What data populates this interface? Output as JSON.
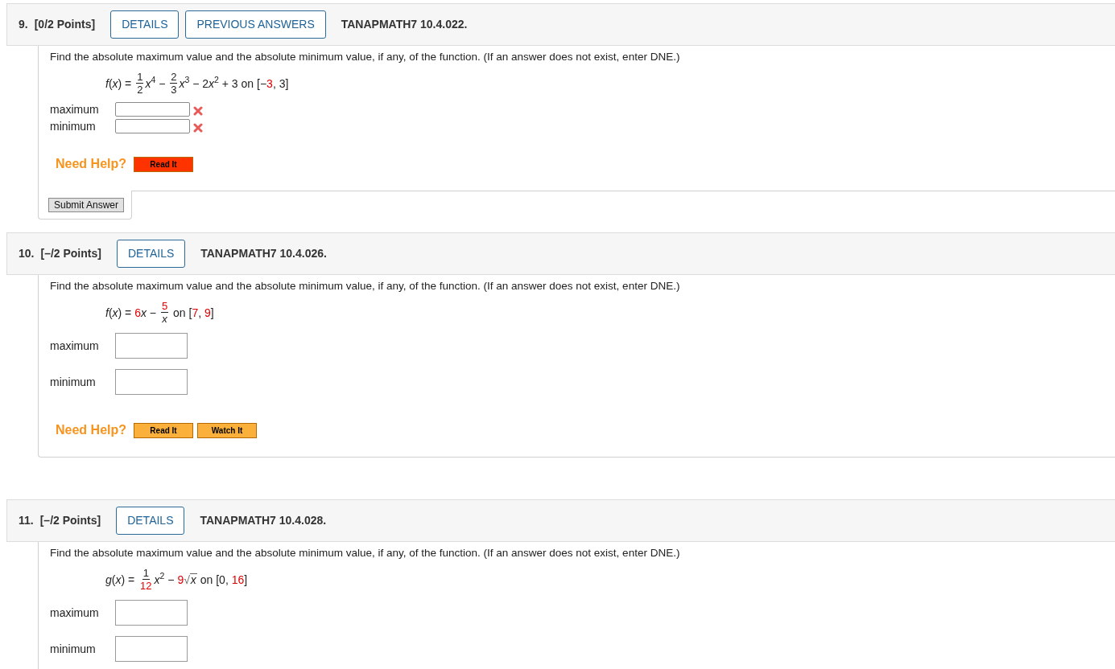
{
  "questions": [
    {
      "number": "9.",
      "points": "[0/2 Points]",
      "kind": "answered",
      "buttons": [
        {
          "label": "DETAILS"
        },
        {
          "label": "PREVIOUS ANSWERS"
        }
      ],
      "code": "TANAPMATH7 10.4.022.",
      "prompt": "Find the absolute maximum value and the absolute minimum value, if any, of the function. (If an answer does not exist, enter DNE.)",
      "formula": [
        {
          "kind": "text",
          "text": "*f*(*x*) = ",
          "highlighted": false
        },
        {
          "kind": "frac",
          "num": {
            "text": "1",
            "highlighted": false
          },
          "den": {
            "text": "2",
            "highlighted": false
          }
        },
        {
          "kind": "text",
          "text": "*x*$^{4}$ − ",
          "highlighted": false
        },
        {
          "kind": "frac",
          "num": {
            "text": "2",
            "highlighted": false
          },
          "den": {
            "text": "3",
            "highlighted": false
          }
        },
        {
          "kind": "text",
          "text": "*x*$^{3}$ − 2",
          "highlighted": false
        },
        {
          "kind": "text",
          "text": "*x*$^{2}$ + 3 on [−",
          "highlighted": false
        },
        {
          "kind": "text",
          "text": "3",
          "highlighted": true
        },
        {
          "kind": "text",
          "text": ", 3]",
          "highlighted": false
        }
      ],
      "answers": [
        {
          "label": "maximum",
          "incorrect": true
        },
        {
          "label": "minimum",
          "incorrect": true
        }
      ],
      "help": {
        "label": "Need Help?",
        "links": [
          {
            "label": "Read It",
            "color": "#ff3300"
          }
        ]
      },
      "submit": "Submit Answer"
    },
    {
      "number": "10.",
      "points": "[–/2 Points]",
      "kind": "unanswered",
      "buttons": [
        {
          "label": "DETAILS"
        }
      ],
      "code": "TANAPMATH7 10.4.026.",
      "prompt": "Find the absolute maximum value and the absolute minimum value, if any, of the function. (If an answer does not exist, enter DNE.)",
      "formula": [
        {
          "kind": "text",
          "text": "*f*(*x*) = ",
          "highlighted": false
        },
        {
          "kind": "text",
          "text": "6",
          "highlighted": true
        },
        {
          "kind": "text",
          "text": "*x* − ",
          "highlighted": false
        },
        {
          "kind": "frac",
          "num": {
            "text": "5",
            "highlighted": true
          },
          "den": {
            "text": "*x*",
            "highlighted": false
          }
        },
        {
          "kind": "text",
          "text": " on [",
          "highlighted": false
        },
        {
          "kind": "text",
          "text": "7",
          "highlighted": true
        },
        {
          "kind": "text",
          "text": ", ",
          "highlighted": false
        },
        {
          "kind": "text",
          "text": "9",
          "highlighted": true
        },
        {
          "kind": "text",
          "text": "]",
          "highlighted": false
        }
      ],
      "answers": [
        {
          "label": "maximum",
          "incorrect": false
        },
        {
          "label": "minimum",
          "incorrect": false
        }
      ],
      "help": {
        "label": "Need Help?",
        "links": [
          {
            "label": "Read It",
            "color": "#fbb03b"
          },
          {
            "label": "Watch It",
            "color": "#fbb03b"
          }
        ]
      }
    },
    {
      "number": "11.",
      "points": "[–/2 Points]",
      "kind": "unanswered",
      "buttons": [
        {
          "label": "DETAILS"
        }
      ],
      "code": "TANAPMATH7 10.4.028.",
      "prompt": "Find the absolute maximum value and the absolute minimum value, if any, of the function. (If an answer does not exist, enter DNE.)",
      "formula": [
        {
          "kind": "text",
          "text": "*g*(*x*) = ",
          "highlighted": false
        },
        {
          "kind": "frac",
          "num": {
            "text": "1",
            "highlighted": false
          },
          "den": {
            "text": "12",
            "highlighted": true
          }
        },
        {
          "kind": "text",
          "text": "*x*$^{2}$ − ",
          "highlighted": false
        },
        {
          "kind": "text",
          "text": "9",
          "highlighted": true
        },
        {
          "kind": "sqrt",
          "sign": "√",
          "radicand": {
            "text": "*x*",
            "highlighted": false
          }
        },
        {
          "kind": "text",
          "text": " on [0, ",
          "highlighted": false
        },
        {
          "kind": "text",
          "text": "16",
          "highlighted": true
        },
        {
          "kind": "text",
          "text": "]",
          "highlighted": false
        }
      ],
      "answers": [
        {
          "label": "maximum",
          "incorrect": false
        },
        {
          "label": "minimum",
          "incorrect": false
        }
      ]
    }
  ]
}
